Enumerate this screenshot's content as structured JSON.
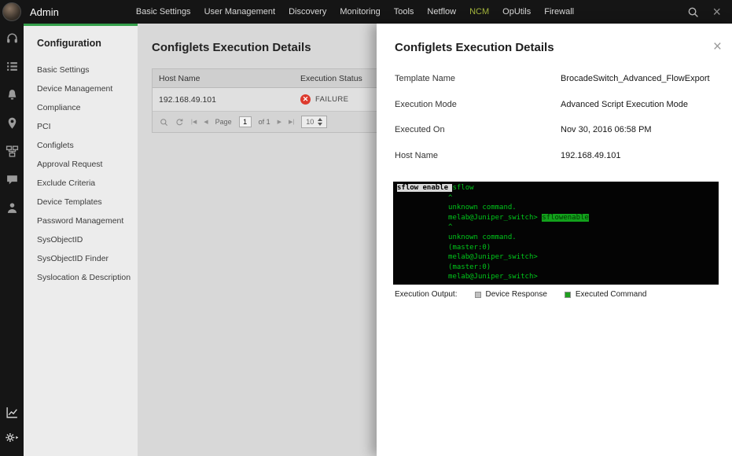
{
  "colors": {
    "accent_green": "#35a04b",
    "active_menu": "#a3b53c",
    "failure_red": "#dd3a2d",
    "terminal_green": "#00c61a"
  },
  "icons": {
    "close": "×",
    "panel_close": "×"
  },
  "topbar": {
    "brand": "Admin",
    "menu": [
      {
        "label": "Basic Settings",
        "active": false
      },
      {
        "label": "User Management",
        "active": false
      },
      {
        "label": "Discovery",
        "active": false
      },
      {
        "label": "Monitoring",
        "active": false
      },
      {
        "label": "Tools",
        "active": false
      },
      {
        "label": "Netflow",
        "active": false
      },
      {
        "label": "NCM",
        "active": true
      },
      {
        "label": "OpUtils",
        "active": false
      },
      {
        "label": "Firewall",
        "active": false
      }
    ]
  },
  "rail": {
    "top_icons": [
      "headset",
      "tasks",
      "alarms",
      "location",
      "inventory",
      "chat",
      "users"
    ],
    "bottom_icons": [
      "reports",
      "settings"
    ]
  },
  "sidebar": {
    "title": "Configuration",
    "items": [
      "Basic Settings",
      "Device Management",
      "Compliance",
      "PCI",
      "Configlets",
      "Approval Request",
      "Exclude Criteria",
      "Device Templates",
      "Password Management",
      "SysObjectID",
      "SysObjectID Finder",
      "Syslocation & Description"
    ]
  },
  "main": {
    "title": "Configlets Execution Details",
    "table": {
      "columns": [
        "Host Name",
        "Execution Status"
      ],
      "rows": [
        {
          "host": "192.168.49.101",
          "status": "FAILURE"
        }
      ]
    },
    "pagination": {
      "first_icon": "|◀",
      "prev_icon": "◀",
      "page_label": "Page",
      "current_page": "1",
      "total_label": "of 1",
      "next_icon": "▶",
      "last_icon": "▶|",
      "page_size": "10"
    }
  },
  "panel": {
    "title": "Configlets Execution Details",
    "fields": [
      {
        "label": "Template Name",
        "value": "BrocadeSwitch_Advanced_FlowExport"
      },
      {
        "label": "Execution Mode",
        "value": "Advanced Script Execution Mode"
      },
      {
        "label": "Executed On",
        "value": "Nov 30, 2016 06:58 PM"
      },
      {
        "label": "Host Name",
        "value": "192.168.49.101"
      }
    ],
    "terminal": {
      "lines": [
        [
          {
            "t": "sflow enable ",
            "s": "dev"
          },
          {
            "t": "sflow",
            "s": "green"
          }
        ],
        [
          {
            "t": "            ^",
            "s": "green"
          }
        ],
        [
          {
            "t": "            unknown command.",
            "s": "green"
          }
        ],
        [
          {
            "t": "            melab@Juniper_switch> ",
            "s": "green"
          },
          {
            "t": "sflowenable",
            "s": "cmd"
          }
        ],
        [
          {
            "t": "            ^",
            "s": "green"
          }
        ],
        [
          {
            "t": "            unknown command.",
            "s": "green"
          }
        ],
        [
          {
            "t": "            (master:0)",
            "s": "green"
          }
        ],
        [
          {
            "t": "            melab@Juniper_switch>",
            "s": "green"
          }
        ],
        [
          {
            "t": "            (master:0)",
            "s": "green"
          }
        ],
        [
          {
            "t": "            melab@Juniper_switch>",
            "s": "green"
          }
        ]
      ]
    },
    "legend": {
      "label": "Execution Output:",
      "items": [
        {
          "label": "Device Response",
          "color": "#c0c0c0"
        },
        {
          "label": "Executed Command",
          "color": "#1fa01f"
        }
      ]
    }
  }
}
